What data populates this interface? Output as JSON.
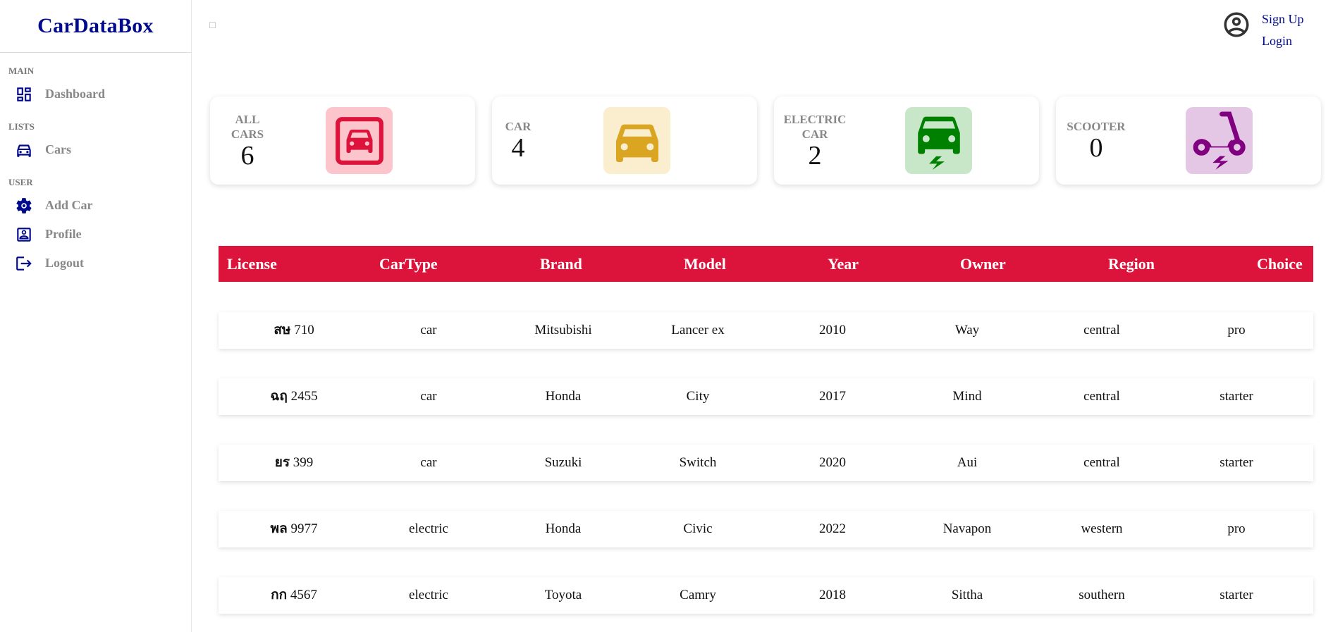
{
  "app": {
    "title": "CarDataBox"
  },
  "sidebar": {
    "sections": [
      {
        "title": "MAIN",
        "items": [
          {
            "label": "Dashboard",
            "icon": "dashboard-icon"
          }
        ]
      },
      {
        "title": "LISTS",
        "items": [
          {
            "label": "Cars",
            "icon": "car-icon"
          }
        ]
      },
      {
        "title": "USER",
        "items": [
          {
            "label": "Add Car",
            "icon": "gear-icon"
          },
          {
            "label": "Profile",
            "icon": "profile-icon"
          },
          {
            "label": "Logout",
            "icon": "logout-icon"
          }
        ]
      }
    ],
    "accent": "#000a8c"
  },
  "header": {
    "user_icon": "user-circle-icon",
    "signup_label": "Sign Up",
    "login_label": "Login"
  },
  "stats": [
    {
      "title_lines": [
        "ALL",
        "CARS"
      ],
      "value": "6",
      "icon": "garage-car-icon",
      "bg": "#fcc5cc",
      "color": "#dc143c"
    },
    {
      "title_lines": [
        "CAR"
      ],
      "value": "4",
      "icon": "car-icon",
      "bg": "#fbeecf",
      "color": "#daa520"
    },
    {
      "title_lines": [
        "ELECTRIC",
        "CAR"
      ],
      "value": "2",
      "icon": "electric-car-icon",
      "bg": "#c8e6c8",
      "color": "#008000"
    },
    {
      "title_lines": [
        "SCOOTER"
      ],
      "value": "0",
      "icon": "electric-scooter-icon",
      "bg": "#e4c7e4",
      "color": "#800080"
    }
  ],
  "table": {
    "header_bg": "#dc143c",
    "columns": [
      "License",
      "CarType",
      "Brand",
      "Model",
      "Year",
      "Owner",
      "Region",
      "Choice"
    ],
    "rows": [
      {
        "license_prefix": "สษ",
        "license_num": "710",
        "cartype": "car",
        "brand": "Mitsubishi",
        "model": "Lancer ex",
        "year": "2010",
        "owner": "Way",
        "region": "central",
        "choice": "pro"
      },
      {
        "license_prefix": "ฉฤ",
        "license_num": "2455",
        "cartype": "car",
        "brand": "Honda",
        "model": "City",
        "year": "2017",
        "owner": "Mind",
        "region": "central",
        "choice": "starter"
      },
      {
        "license_prefix": "ยร",
        "license_num": "399",
        "cartype": "car",
        "brand": "Suzuki",
        "model": "Switch",
        "year": "2020",
        "owner": "Aui",
        "region": "central",
        "choice": "starter"
      },
      {
        "license_prefix": "พล",
        "license_num": "9977",
        "cartype": "electric",
        "brand": "Honda",
        "model": "Civic",
        "year": "2022",
        "owner": "Navapon",
        "region": "western",
        "choice": "pro"
      },
      {
        "license_prefix": "กก",
        "license_num": "4567",
        "cartype": "electric",
        "brand": "Toyota",
        "model": "Camry",
        "year": "2018",
        "owner": "Sittha",
        "region": "southern",
        "choice": "starter"
      }
    ]
  }
}
